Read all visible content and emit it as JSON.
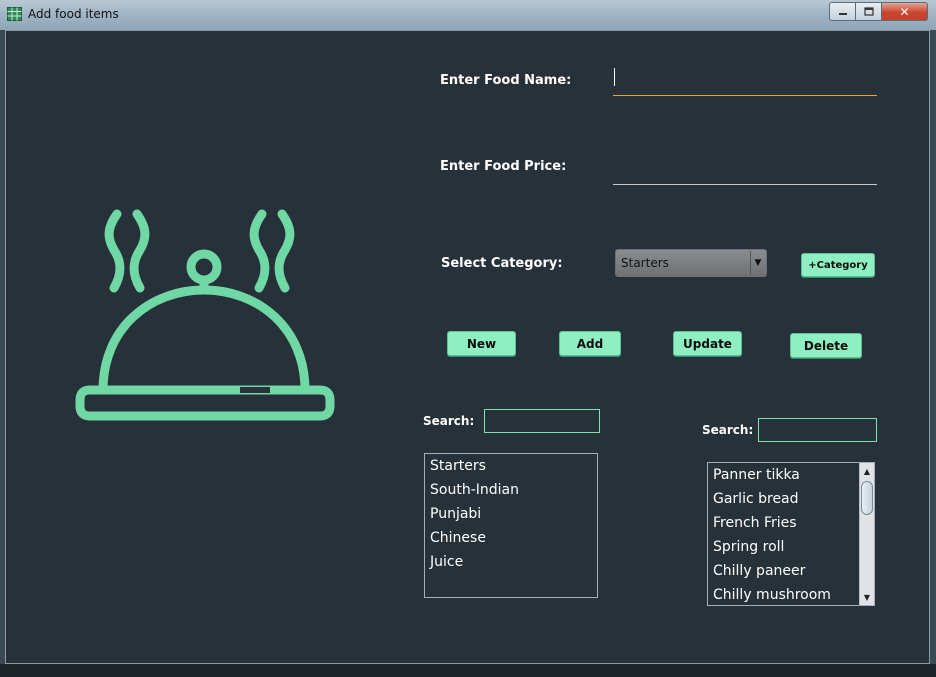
{
  "window": {
    "title": "Add food items",
    "close_glyph": "✕"
  },
  "form": {
    "food_name_label": "Enter Food Name:",
    "food_name_value": "",
    "food_price_label": "Enter Food Price:",
    "food_price_value": "",
    "category_label": "Select Category:",
    "category_selected": "Starters",
    "add_category_label": "+Category"
  },
  "actions": {
    "new_label": "New",
    "add_label": "Add",
    "update_label": "Update",
    "delete_label": "Delete"
  },
  "category_panel": {
    "search_label": "Search:",
    "search_value": "",
    "items": [
      "Starters",
      "South-Indian",
      "Punjabi",
      "Chinese",
      "Juice"
    ]
  },
  "food_panel": {
    "search_label": "Search:",
    "search_value": "",
    "items": [
      "Panner tikka",
      "Garlic bread",
      "French Fries",
      "Spring roll",
      "Chilly paneer",
      "Chilly mushroom"
    ]
  },
  "icons": {
    "app": "table-icon",
    "illustration": "food-cloche-icon"
  },
  "colors": {
    "background": "#263139",
    "accent": "#6fd8a4",
    "button": "#8ef0c2",
    "focus_underline": "#e6a33b"
  }
}
